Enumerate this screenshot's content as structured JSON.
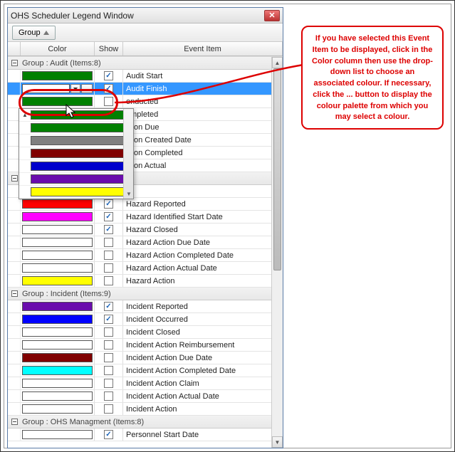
{
  "window": {
    "title": "OHS Scheduler Legend Window"
  },
  "toolbar": {
    "group_label": "Group"
  },
  "headers": {
    "color": "Color",
    "show": "Show",
    "event": "Event Item"
  },
  "callout": {
    "text": "If you have selected this Event Item to be displayed, click in the Color column then use the drop-down list to choose an associated colour. If necessary, click the ... button to display the colour palette from which you may select a colour."
  },
  "groups": [
    {
      "label": "Group : Audit (Items:8)",
      "expanded": true,
      "rows": [
        {
          "color": "#008000",
          "checked": true,
          "label": "Audit Start",
          "selected": false
        },
        {
          "color": "#ffffff",
          "checked": true,
          "label": "Audit Finish",
          "selected": true,
          "editor": true
        },
        {
          "color": "#008000",
          "checked": false,
          "label": "onducted",
          "partial": true
        },
        {
          "color": "#008000",
          "checked": false,
          "label": "ompleted",
          "partial": true
        },
        {
          "color": "#808080",
          "checked": false,
          "label": "ction Due",
          "partial": true
        },
        {
          "color": "#800000",
          "checked": false,
          "label": "ction Created Date",
          "partial": true
        },
        {
          "color": "#0000cc",
          "checked": false,
          "label": "ction Completed",
          "partial": true
        },
        {
          "color": "#6a0dad",
          "checked": false,
          "label": "ction Actual",
          "partial": true
        }
      ]
    },
    {
      "label": "",
      "expanded": true,
      "rows": [
        {
          "color": "#ffff00",
          "checked": false,
          "label": ""
        },
        {
          "color": "#ff0000",
          "checked": true,
          "label": "Hazard Reported"
        },
        {
          "color": "#ff00ff",
          "checked": true,
          "label": "Hazard Identified Start Date"
        },
        {
          "color": "#ffffff",
          "checked": true,
          "label": "Hazard Closed"
        },
        {
          "color": "#ffffff",
          "checked": false,
          "label": "Hazard Action Due Date"
        },
        {
          "color": "#ffffff",
          "checked": false,
          "label": "Hazard Action Completed Date"
        },
        {
          "color": "#ffffff",
          "checked": false,
          "label": "Hazard Action Actual Date"
        },
        {
          "color": "#ffff00",
          "checked": false,
          "label": "Hazard Action"
        }
      ]
    },
    {
      "label": "Group : Incident (Items:9)",
      "expanded": true,
      "rows": [
        {
          "color": "#6a0dad",
          "checked": true,
          "label": "Incident Reported"
        },
        {
          "color": "#0000ff",
          "checked": true,
          "label": "Incident Occurred"
        },
        {
          "color": "#ffffff",
          "checked": false,
          "label": "Incident Closed"
        },
        {
          "color": "#ffffff",
          "checked": false,
          "label": "Incident Action Reimbursement"
        },
        {
          "color": "#800000",
          "checked": false,
          "label": "Incident Action Due Date"
        },
        {
          "color": "#00ffff",
          "checked": false,
          "label": "Incident Action Completed Date"
        },
        {
          "color": "#ffffff",
          "checked": false,
          "label": "Incident Action Claim"
        },
        {
          "color": "#ffffff",
          "checked": false,
          "label": "Incident Action Actual Date"
        },
        {
          "color": "#ffffff",
          "checked": false,
          "label": "Incident Action"
        }
      ]
    },
    {
      "label": "Group : OHS Managment (Items:8)",
      "expanded": true,
      "rows": [
        {
          "color": "#ffffff",
          "checked": true,
          "label": "Personnel Start Date"
        }
      ]
    }
  ],
  "dropdown_colors": [
    "#008000",
    "#008000",
    "#808080",
    "#800000",
    "#0000cc",
    "#6a0dad",
    "#ffff00"
  ]
}
